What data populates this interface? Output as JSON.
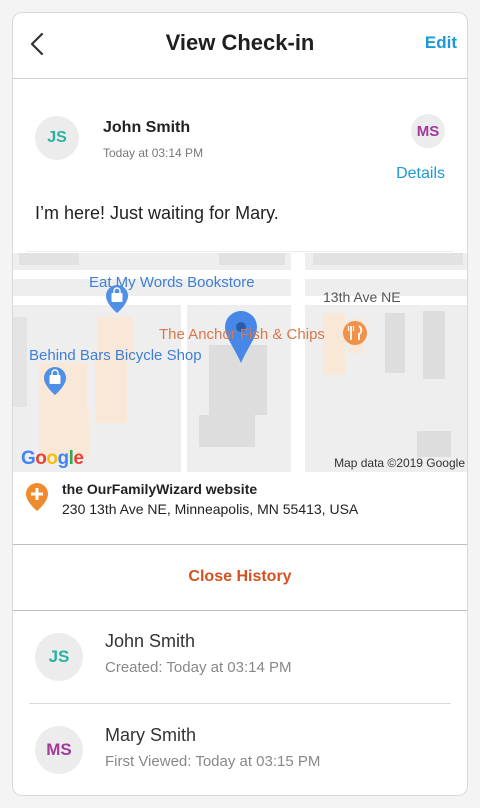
{
  "header": {
    "title": "View Check-in",
    "edit_label": "Edit"
  },
  "checkin": {
    "author_initials": "JS",
    "author_name": "John Smith",
    "timestamp": "Today at 03:14 PM",
    "recipient_initials": "MS",
    "details_label": "Details",
    "message": "I’m here! Just waiting for Mary."
  },
  "map": {
    "pois": [
      "Eat My Words Bookstore",
      "Behind Bars Bicycle Shop",
      "The Anchor Fish & Chips"
    ],
    "street_label": "13th Ave NE",
    "credit": "Map data ©2019 Google",
    "logo_text": "Google"
  },
  "location": {
    "name": "the OurFamilyWizard website",
    "address": "230 13th Ave NE, Minneapolis, MN 55413, USA"
  },
  "history": {
    "close_label": "Close History",
    "entries": [
      {
        "initials": "JS",
        "name": "John Smith",
        "detail": "Created: Today at 03:14 PM"
      },
      {
        "initials": "MS",
        "name": "Mary Smith",
        "detail": "First Viewed: Today at 03:15 PM"
      }
    ]
  },
  "colors": {
    "accent_blue": "#1b9ad7",
    "accent_orange": "#d2531f",
    "js_initials": "#2bb1a0",
    "ms_initials": "#a33a9b"
  },
  "icons": [
    "chevron-left-icon",
    "map-pin-icon",
    "shopping-bag-marker-icon",
    "restaurant-marker-icon",
    "location-plus-icon"
  ]
}
